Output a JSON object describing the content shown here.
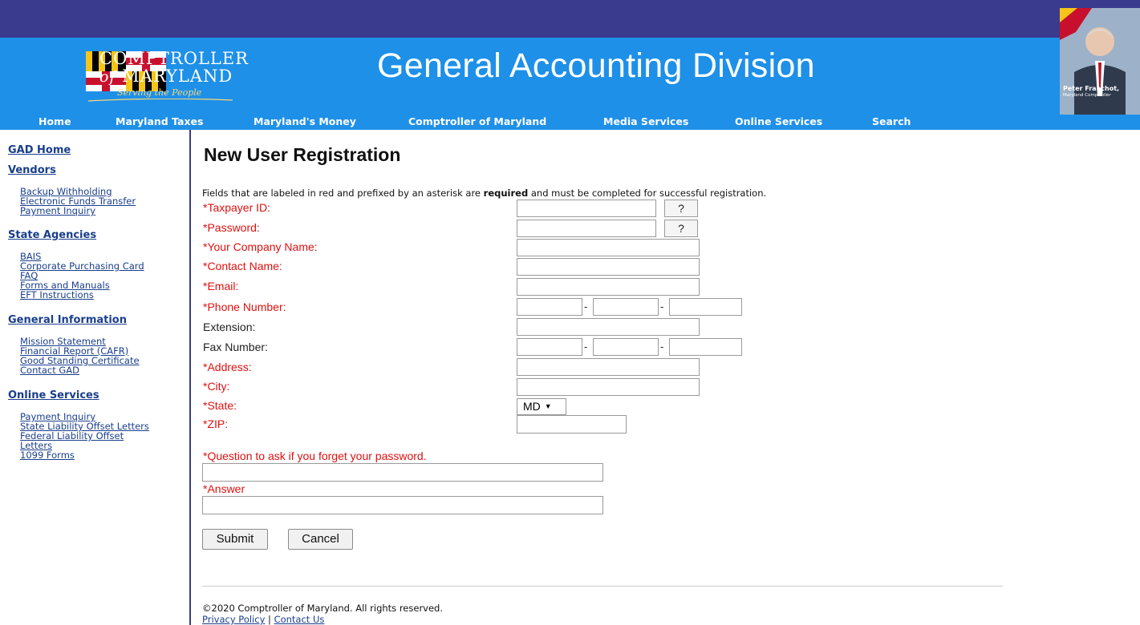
{
  "header": {
    "logo_line1": "COMPTROLLER",
    "logo_of": "of",
    "logo_line2": "MARYLAND",
    "logo_tagline": "Serving the People",
    "title": "General Accounting Division",
    "portrait_name": "Peter Franchot,",
    "portrait_title": "Maryland Comptroller"
  },
  "nav": [
    "Home",
    "Maryland Taxes",
    "Maryland's Money",
    "Comptroller of Maryland",
    "Media Services",
    "Online Services",
    "Search"
  ],
  "sidebar": {
    "gad_home": "GAD Home",
    "vendors": "Vendors",
    "vendor_links": [
      "Backup Withholding",
      "Electronic Funds Transfer",
      "Payment Inquiry"
    ],
    "state_agencies": "State Agencies",
    "agency_links": [
      "BAIS",
      "Corporate Purchasing Card",
      "FAQ",
      "Forms and Manuals",
      "EFT Instructions"
    ],
    "general_information": "General Information",
    "general_links": [
      "Mission Statement",
      "Financial Report (CAFR)",
      "Good Standing Certificate",
      "Contact GAD"
    ],
    "online_services": "Online Services",
    "online_links": [
      "Payment Inquiry",
      "State Liability Offset Letters",
      "Federal Liability Offset",
      "Letters",
      "1099 Forms"
    ]
  },
  "main": {
    "title": "New User Registration",
    "intro_before": "Fields that are labeled in red and prefixed by an asterisk are ",
    "intro_bold": "required",
    "intro_after": " and must be completed for successful registration."
  },
  "form": {
    "taxpayer_id": "*Taxpayer ID:",
    "password": "*Password:",
    "company_name": "*Your Company Name:",
    "contact_name": "*Contact Name:",
    "email": "*Email:",
    "phone": "*Phone Number:",
    "extension": "Extension:",
    "fax": "Fax Number:",
    "address": "*Address:",
    "city": "*City:",
    "state": "*State:",
    "zip": "*ZIP:",
    "question": "*Question to ask if you forget your password.",
    "answer": "*Answer",
    "help_label": "?",
    "dash": "-",
    "state_value": "MD",
    "submit": "Submit",
    "cancel": "Cancel"
  },
  "footer": {
    "copyright": "©2020 Comptroller of Maryland. All rights reserved.",
    "privacy": "Privacy Policy",
    "separator": " | ",
    "contact": "Contact Us"
  },
  "colors": {
    "top_bar": "#3a3a8e",
    "banner": "#1e90e8",
    "required_label": "#e01010",
    "link": "#1a3e8c"
  }
}
